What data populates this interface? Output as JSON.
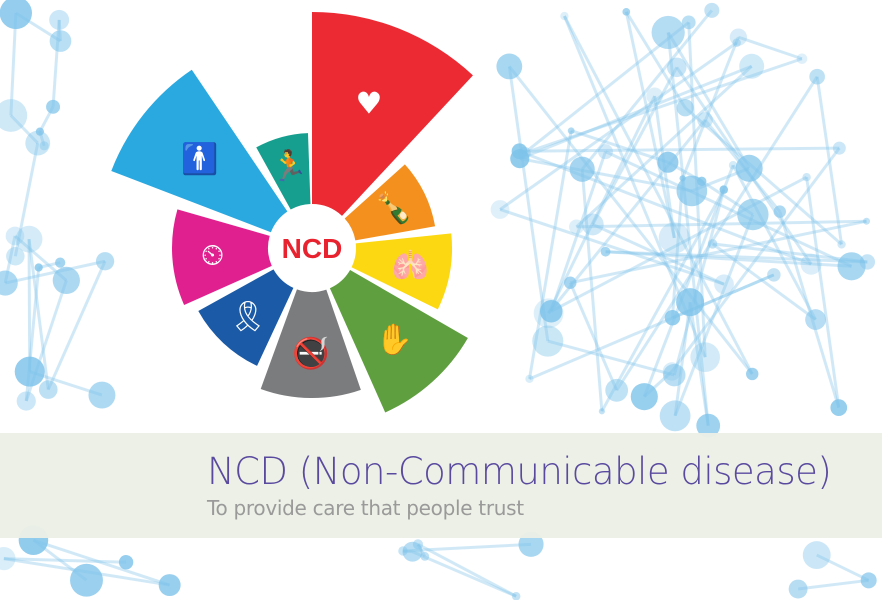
{
  "banner": {
    "title": "NCD (Non-Communicable disease)",
    "subtitle": "To provide care that people trust",
    "title_color": "#5a4a9f",
    "subtitle_color": "#9a9a9a",
    "band_color": "#ebf0e5"
  },
  "wheel": {
    "center_label": "NCD",
    "center_label_color": "#e8232f",
    "segments": [
      {
        "name": "heart-care",
        "icon": "heart-in-hands-icon",
        "glyph": "♥",
        "color": "#ec2a33"
      },
      {
        "name": "alcohol",
        "icon": "bottles-icon",
        "glyph": "🍾",
        "color": "#f4901e"
      },
      {
        "name": "lungs",
        "icon": "lungs-icon",
        "glyph": "🫁",
        "color": "#fcd813"
      },
      {
        "name": "stop",
        "icon": "raised-hand-icon",
        "glyph": "✋",
        "color": "#5f9f3f"
      },
      {
        "name": "no-smoking",
        "icon": "no-smoking-icon",
        "glyph": "🚭",
        "color": "#7b7c7e"
      },
      {
        "name": "cancer-ribbon",
        "icon": "ribbon-icon",
        "glyph": "🎗",
        "color": "#1b5aa6"
      },
      {
        "name": "blood-pressure",
        "icon": "blood-pressure-monitor-icon",
        "glyph": "⏲",
        "color": "#e0208f"
      },
      {
        "name": "obesity",
        "icon": "person-scale-icon",
        "glyph": "🚹",
        "color": "#2aa8e0"
      },
      {
        "name": "exercise",
        "icon": "active-person-icon",
        "glyph": "🏃",
        "color": "#169e8e"
      }
    ]
  },
  "background": {
    "molecule_color": "#7ec3ea"
  }
}
